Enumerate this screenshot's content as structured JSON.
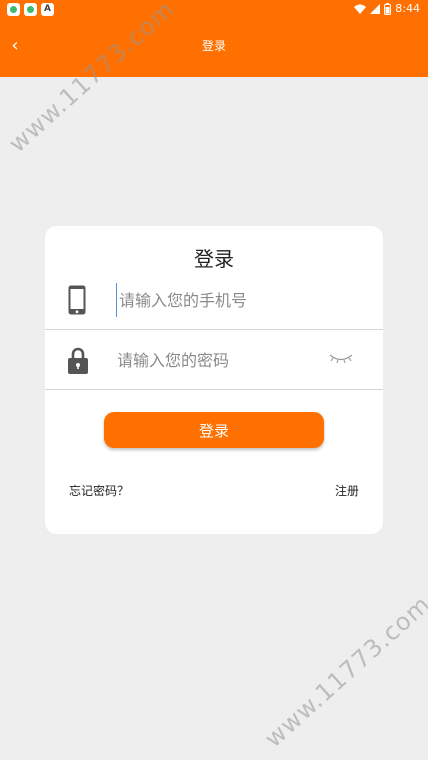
{
  "status_bar": {
    "time": "8:44",
    "icons": [
      "app-notification-icon",
      "app-notification-icon",
      "a-notification-icon",
      "wifi-icon",
      "signal-icon",
      "battery-icon"
    ],
    "notif_letter": "A"
  },
  "header": {
    "title": "登录",
    "back_icon": "chevron-left-icon",
    "back_glyph": "‹",
    "color": "#ff7000"
  },
  "watermark": "www.11773.com",
  "card": {
    "title": "登录",
    "phone": {
      "placeholder": "请输入您的手机号",
      "value": "",
      "icon": "phone-icon"
    },
    "password": {
      "placeholder": "请输入您的密码",
      "value": "",
      "icon": "lock-icon",
      "toggle_icon": "eye-closed-icon"
    },
    "login_button": "登录",
    "forgot_link": "忘记密码？",
    "register_link": "注册"
  }
}
